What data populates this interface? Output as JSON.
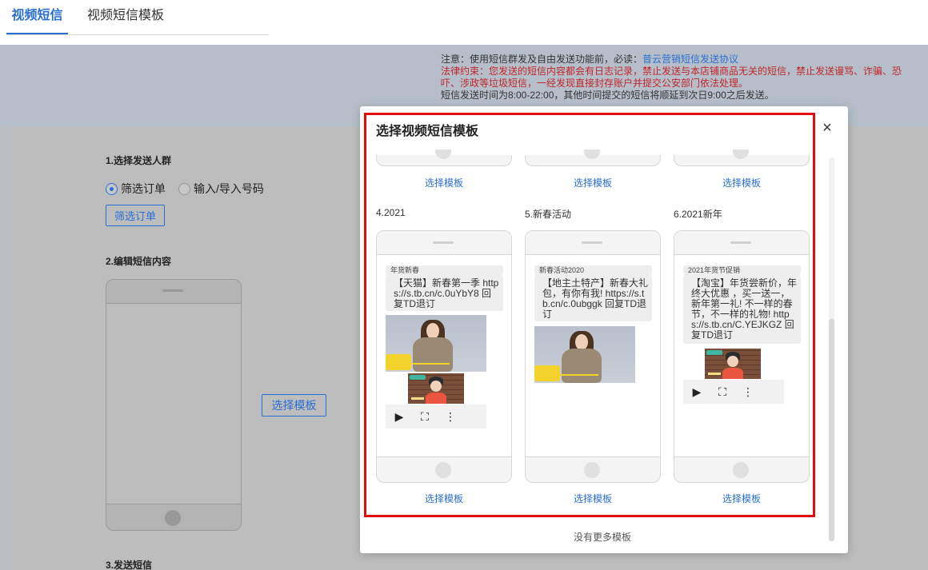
{
  "tabs": [
    {
      "label": "视频短信",
      "active": true
    },
    {
      "label": "视频短信模板",
      "active": false
    }
  ],
  "notice": {
    "line1_prefix": "注意：使用短信群发及自由发送功能前，必读：",
    "line1_link": "普云营销短信发送协议",
    "line2": "法律约束：您发送的短信内容都会有日志记录，禁止发送与本店铺商品无关的短信，禁止发送谩骂、诈骗、恐吓、涉政等垃圾短信，一经发现直接封存账户并提交公安部门依法处理。",
    "line3": "短信发送时间为8:00-22:00，其他时间提交的短信将顺延到次日9:00之后发送。"
  },
  "form": {
    "step1_title": "1.选择发送人群",
    "radio_filter": "筛选订单",
    "radio_input": "输入/导入号码",
    "filter_button": "筛选订单",
    "step2_title": "2.编辑短信内容",
    "choose_template_button": "选择模板",
    "step3_title": "3.发送短信"
  },
  "modal": {
    "title": "选择视频短信模板",
    "close": "×",
    "select_label": "选择模板",
    "no_more": "没有更多模板",
    "templates": [
      {
        "name": "4.2021",
        "tag": "年货新春",
        "message": "【天猫】新春第一季 https://s.tb.cn/c.0uYbY8  回复TD退订"
      },
      {
        "name": "5.新春活动",
        "tag": "新春活动2020",
        "message": "【地主土特产】新春大礼包，有你有我!  https://s.tb.cn/c.0ubggk  回复TD退订"
      },
      {
        "name": "6.2021新年",
        "tag": "2021年货节促销",
        "message": "【淘宝】年货尝新价，年终大优惠 ，买一送一，新年第一礼! 不一样的春节，不一样的礼物!  https://s.tb.cn/C.YEJKGZ  回复TD退订"
      }
    ],
    "video_controls": {
      "play": "▶",
      "fullscreen": "⛶",
      "more": "⋮"
    }
  },
  "colors": {
    "accent": "#2a6fd0",
    "warning": "#c0262d",
    "highlight_box": "#e10d0d",
    "overlay_bg": "#bdbdbd"
  }
}
